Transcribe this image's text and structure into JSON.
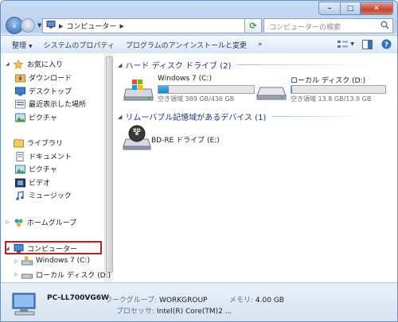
{
  "window": {
    "caption_min": "–",
    "caption_max": "□",
    "caption_close": "✕"
  },
  "address": {
    "crumb": "コンピューター"
  },
  "search": {
    "placeholder": "コンピューターの検索"
  },
  "toolbar": {
    "organize": "整理",
    "system_properties": "システムのプロパティ",
    "uninstall": "プログラムのアンインストールと変更",
    "more": "»"
  },
  "nav": {
    "favorites": "お気に入り",
    "downloads": "ダウンロード",
    "desktop": "デスクトップ",
    "recent": "最近表示した場所",
    "pictures_fav": "ピクチャ",
    "libraries": "ライブラリ",
    "documents": "ドキュメント",
    "pictures": "ピクチャ",
    "videos": "ビデオ",
    "music": "ミュージック",
    "homegroup": "ホームグループ",
    "computer": "コンピューター",
    "win7": "Windows 7 (C:)",
    "local_disk": "ローカル ディスク (D:)"
  },
  "content": {
    "hdd_group": "ハード ディスク ドライブ (2)",
    "removable_group": "リムーバブル記憶域があるデバイス (1)",
    "drives": [
      {
        "name": "Windows 7 (C:)",
        "space": "空き領域 389 GB/436 GB",
        "used_fraction": 0.11
      },
      {
        "name": "ローカル ディスク (D:)",
        "space": "空き領域 13.8 GB/13.9 GB",
        "used_fraction": 0.01
      }
    ],
    "bd_name": "BD-RE ドライブ (E:)",
    "bd_label": "BD"
  },
  "details": {
    "computer_name": "PC-LL700VG6W",
    "workgroup_label": "ワークグループ:",
    "workgroup_value": "WORKGROUP",
    "memory_label": "メモリ:",
    "memory_value": "4.00 GB",
    "processor_label": "プロセッサ:",
    "processor_value": "Intel(R) Core(TM)2 ..."
  },
  "colors": {
    "highlight": "#d0191e",
    "drive_bar": "#1d84c8"
  }
}
